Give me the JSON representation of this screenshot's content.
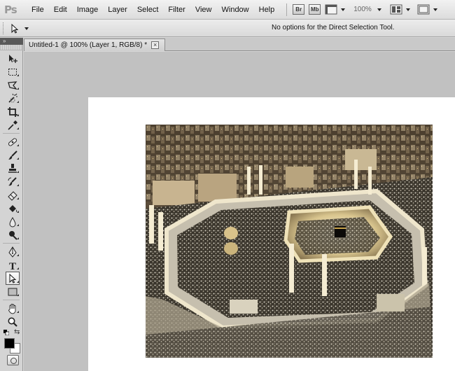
{
  "app": {
    "logo_text": "Ps"
  },
  "menubar": {
    "items": [
      "File",
      "Edit",
      "Image",
      "Layer",
      "Select",
      "Filter",
      "View",
      "Window",
      "Help"
    ],
    "bridge_label": "Br",
    "minibridge_label": "Mb",
    "zoom_level": "100%"
  },
  "options_bar": {
    "tool_icon": "direct-selection-icon",
    "message": "No options for the Direct Selection Tool."
  },
  "toolbox": {
    "tools": [
      {
        "name": "move-tool",
        "icon": "move-icon"
      },
      {
        "name": "marquee-tool",
        "icon": "rect-marquee-icon"
      },
      {
        "name": "lasso-tool",
        "icon": "polygonal-lasso-icon"
      },
      {
        "name": "quick-selection-tool",
        "icon": "magic-wand-icon"
      },
      {
        "name": "crop-tool",
        "icon": "crop-icon"
      },
      {
        "name": "eyedropper-tool",
        "icon": "eyedropper-icon"
      },
      {
        "name": "healing-brush-tool",
        "icon": "bandage-icon"
      },
      {
        "name": "brush-tool",
        "icon": "brush-icon"
      },
      {
        "name": "clone-stamp-tool",
        "icon": "stamp-icon"
      },
      {
        "name": "history-brush-tool",
        "icon": "history-brush-icon"
      },
      {
        "name": "eraser-tool",
        "icon": "eraser-icon"
      },
      {
        "name": "paint-bucket-tool",
        "icon": "paint-bucket-icon"
      },
      {
        "name": "blur-tool",
        "icon": "blur-icon"
      },
      {
        "name": "dodge-tool",
        "icon": "dodge-icon"
      },
      {
        "name": "pen-tool",
        "icon": "pen-icon"
      },
      {
        "name": "type-tool",
        "icon": "type-icon"
      },
      {
        "name": "direct-selection-tool",
        "icon": "direct-selection-icon",
        "active": true
      },
      {
        "name": "shape-tool",
        "icon": "rectangle-shape-icon"
      },
      {
        "name": "hand-tool",
        "icon": "hand-icon"
      },
      {
        "name": "zoom-tool",
        "icon": "zoom-icon"
      }
    ],
    "foreground_color": "#000000",
    "background_color": "#ffffff",
    "type_label": "T"
  },
  "document": {
    "tab_title": "Untitled-1 @ 100% (Layer 1, RGB/8) *",
    "close_glyph": "×",
    "canvas_bg": "#ffffff",
    "workspace_bg": "#c1c1c1",
    "image_subject": "aerial-night-photo"
  }
}
